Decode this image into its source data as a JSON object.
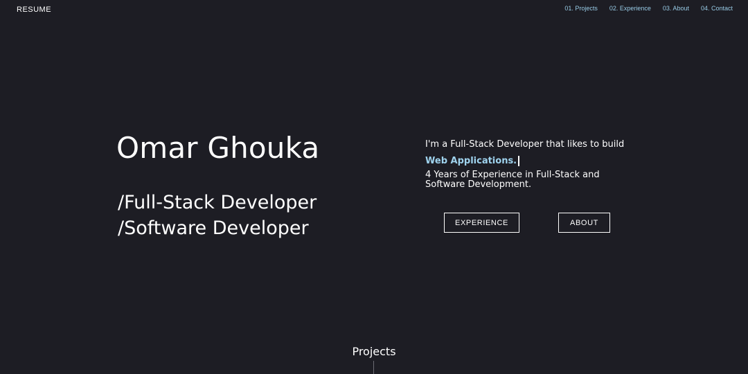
{
  "header": {
    "logo": "RESUME",
    "nav": [
      {
        "label": "01. Projects"
      },
      {
        "label": "02. Experience"
      },
      {
        "label": "03. About"
      },
      {
        "label": "04. Contact"
      }
    ]
  },
  "hero": {
    "name": "Omar Ghouka",
    "roles": [
      "/Full-Stack Developer",
      "/Software Developer"
    ],
    "intro": "I'm a Full-Stack Developer that likes to build",
    "typed": "Web Applications.",
    "experience": "4 Years of Experience in Full-Stack and Software Development.",
    "buttons": {
      "experience": "EXPERIENCE",
      "about": "ABOUT"
    }
  },
  "projects": {
    "title": "Projects"
  },
  "colors": {
    "background": "#1d1d24",
    "accent": "#9fd3ee",
    "nav": "#98cbe6"
  }
}
